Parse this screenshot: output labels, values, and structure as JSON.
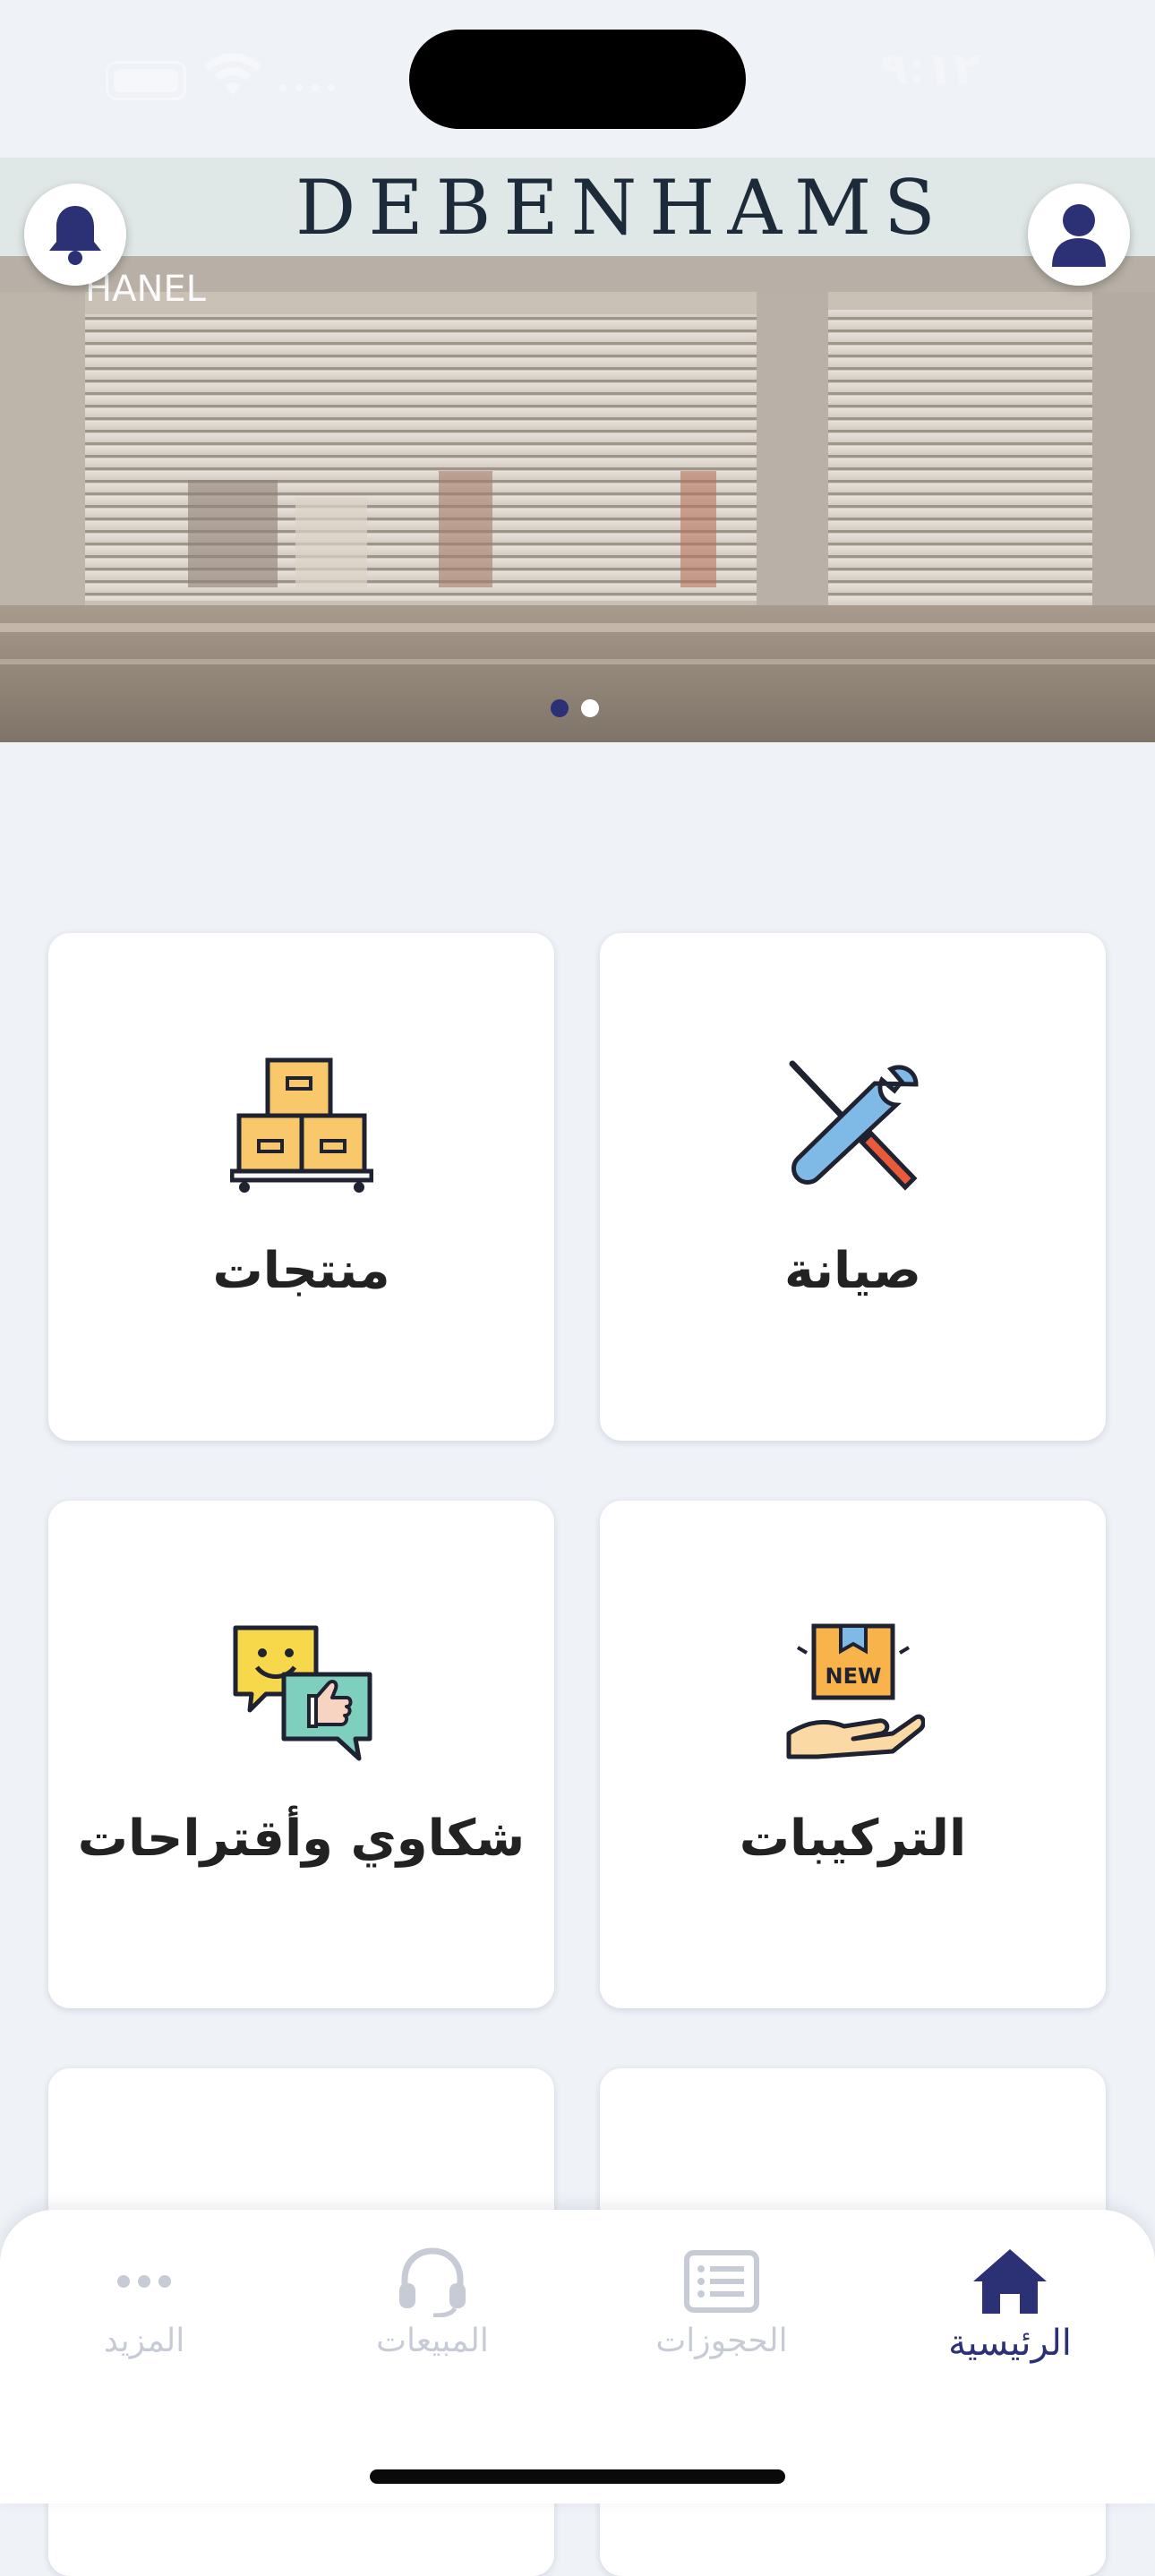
{
  "status_bar": {
    "time": "٩:١٢"
  },
  "banner": {
    "store_sign": "DEBENHAMS",
    "store_sign_2": "HANEL",
    "slide_count": 2,
    "active_slide": 0
  },
  "cards": [
    {
      "label": "صيانة",
      "icon": "tools-icon"
    },
    {
      "label": "منتجات",
      "icon": "boxes-icon"
    },
    {
      "label": "التركيبات",
      "icon": "new-package-hand-icon"
    },
    {
      "label": "شكاوي وأقتراحات",
      "icon": "feedback-chat-icon"
    }
  ],
  "tabbar": {
    "home": "الرئيسية",
    "bookings": "الحجوزات",
    "sales": "المبيعات",
    "more": "المزيد"
  },
  "colors": {
    "accent": "#2c3176",
    "inactive": "#c7cbd6",
    "background": "#eff2f7"
  }
}
